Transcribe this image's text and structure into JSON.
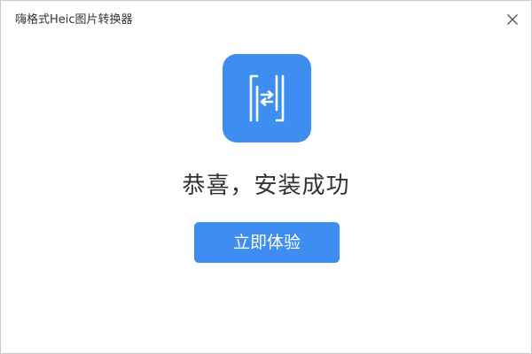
{
  "window": {
    "title": "嗨格式Heic图片转换器",
    "close_icon": "close-icon"
  },
  "logo": {
    "icon": "heic-converter-logo-icon",
    "color": "#3d8ef0"
  },
  "main": {
    "message": "恭喜，安装成功",
    "start_button_label": "立即体验"
  },
  "colors": {
    "accent": "#3d8ef0",
    "text": "#333333",
    "border": "#c9c9c9"
  }
}
